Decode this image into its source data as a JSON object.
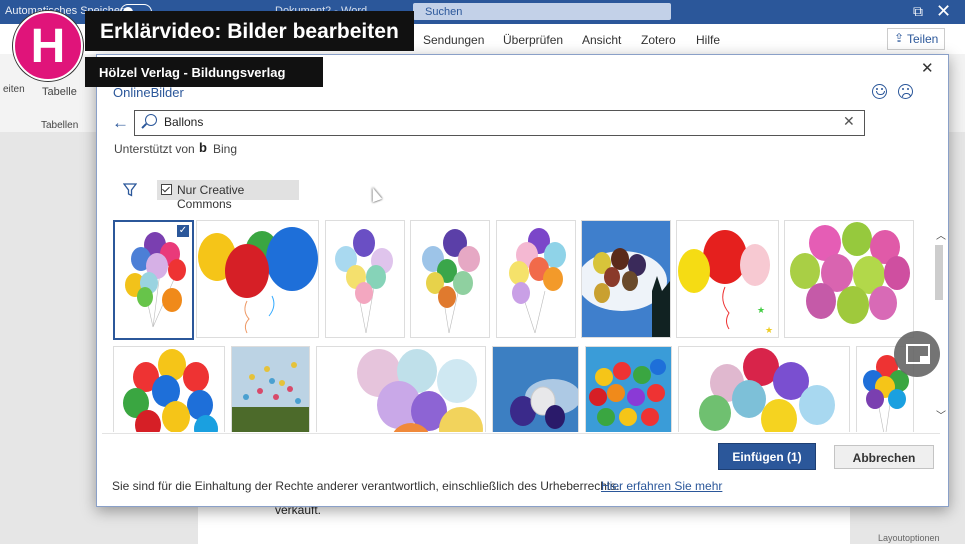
{
  "word": {
    "autosave_label": "Automatisches Speichern",
    "doc_name": "Dokument2 - Word",
    "search_placeholder": "Suchen",
    "ribbon_tabs": [
      "Sendungen",
      "Überprüfen",
      "Ansicht",
      "Zotero",
      "Hilfe"
    ],
    "share_label": "Teilen",
    "ribbon_group_label": "Tabellen",
    "ribbon_button_table": "Tabelle",
    "ribbon_button_left": "eiten",
    "page_text": "verkauft.",
    "page_text_right": "Layoutoptionen"
  },
  "dialog": {
    "title": "OnlineBilder",
    "search_value": "Ballons",
    "powered_by": "Unterstützt von",
    "bing": "Bing",
    "filter_label": "Nur Creative Commons",
    "insert_label": "Einfügen (1)",
    "cancel_label": "Abbrechen",
    "rights_text": "Sie sind für die Einhaltung der Rechte anderer verantwortlich, einschließlich des Urheberrechts.",
    "learn_more": "Hier erfahren Sie mehr"
  },
  "overlay": {
    "logo_letter": "H",
    "video_title": "Erklärvideo: Bilder bearbeiten",
    "publisher": "Hölzel Verlag - Bildungsverlag"
  },
  "colors": {
    "word_blue": "#2b579a",
    "logo_pink": "#e0147a"
  }
}
